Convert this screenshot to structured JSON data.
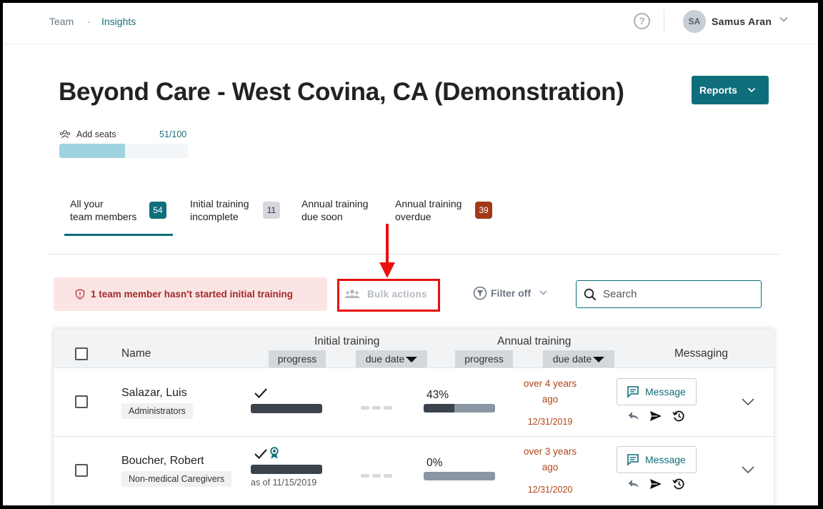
{
  "nav": {
    "crumb_team": "Team",
    "crumb_separator": "·",
    "crumb_insights": "Insights",
    "help_glyph": "?",
    "user_initials": "SA",
    "user_name": "Samus Aran"
  },
  "header": {
    "title": "Beyond Care - West Covina, CA (Demonstration)",
    "reports_label": "Reports"
  },
  "seats": {
    "label": "Add seats",
    "count_text": "51/100",
    "fill_fraction": 0.51
  },
  "tabs": [
    {
      "line1": "All your",
      "line2": "team members",
      "badge": "54",
      "badge_bg": "#0f6e7b",
      "badge_color": "#ffffff",
      "active": true
    },
    {
      "line1": "Initial training",
      "line2": "incomplete",
      "badge": "11",
      "badge_bg": "#d4d8dc",
      "badge_color": "#333333",
      "active": false
    },
    {
      "line1": "Annual training",
      "line2": "due soon",
      "badge": "",
      "active": false
    },
    {
      "line1": "Annual training",
      "line2": "overdue",
      "badge": "39",
      "badge_bg": "#a3391b",
      "badge_color": "#ffffff",
      "active": false
    }
  ],
  "alert": {
    "text": "1 team member hasn't started initial training"
  },
  "bulk_actions": {
    "label": "Bulk actions"
  },
  "filter": {
    "label": "Filter off"
  },
  "search": {
    "placeholder": "Search",
    "value": ""
  },
  "table": {
    "col_name": "Name",
    "col_initial": "Initial training",
    "col_annual": "Annual training",
    "col_messaging": "Messaging",
    "sub_progress": "progress",
    "sub_due_date": "due date",
    "rows": [
      {
        "name": "Salazar, Luis",
        "group": "Administrators",
        "initial_complete": true,
        "certificate": false,
        "as_of": "",
        "annual_percent": "43%",
        "annual_fraction": 0.43,
        "overdue_line1": "over 4 years",
        "overdue_line2": "ago",
        "due_date": "12/31/2019",
        "message_label": "Message"
      },
      {
        "name": "Boucher, Robert",
        "group": "Non-medical Caregivers",
        "initial_complete": true,
        "certificate": true,
        "as_of": "as of 11/15/2019",
        "annual_percent": "0%",
        "annual_fraction": 0,
        "overdue_line1": "over 3 years",
        "overdue_line2": "ago",
        "due_date": "12/31/2020",
        "message_label": "Message"
      }
    ]
  },
  "colors": {
    "brand": "#0f6e7b",
    "alert_bg": "#fbe4e4",
    "alert_text": "#a12b2b",
    "overdue_text": "#b04618",
    "annotation_red": "#e81010"
  }
}
